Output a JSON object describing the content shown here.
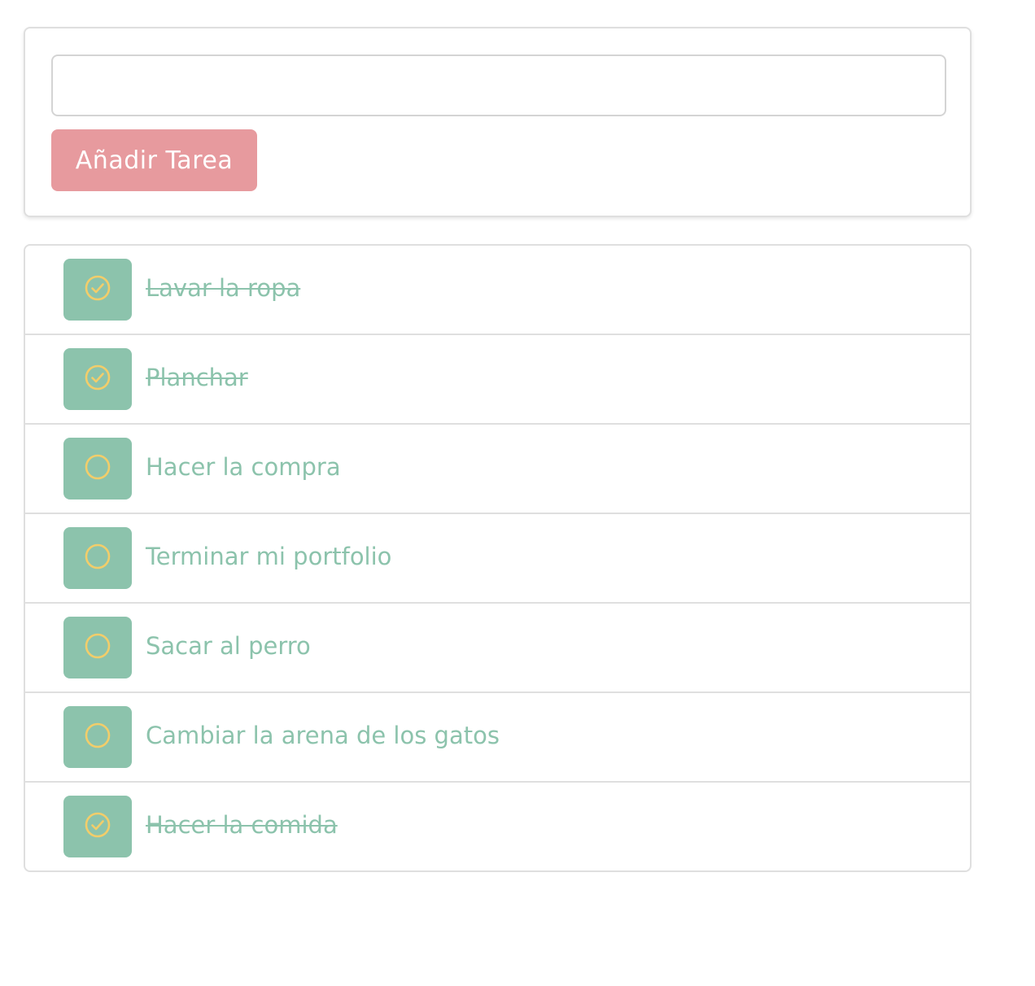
{
  "add_task": {
    "input_value": "",
    "input_placeholder": "",
    "button_label": "Añadir Tarea"
  },
  "colors": {
    "accent_green": "#8cc3ac",
    "button_pink": "#e79a9e",
    "icon_yellow": "#f2cd6a"
  },
  "tasks": [
    {
      "label": "Lavar la ropa",
      "done": true,
      "icon": "check-circle-icon"
    },
    {
      "label": "Planchar",
      "done": true,
      "icon": "check-circle-icon"
    },
    {
      "label": "Hacer la compra",
      "done": false,
      "icon": "circle-icon"
    },
    {
      "label": "Terminar mi portfolio",
      "done": false,
      "icon": "circle-icon"
    },
    {
      "label": "Sacar al perro",
      "done": false,
      "icon": "circle-icon"
    },
    {
      "label": "Cambiar la arena de los gatos",
      "done": false,
      "icon": "circle-icon"
    },
    {
      "label": "Hacer la comida",
      "done": true,
      "icon": "check-circle-icon"
    }
  ]
}
